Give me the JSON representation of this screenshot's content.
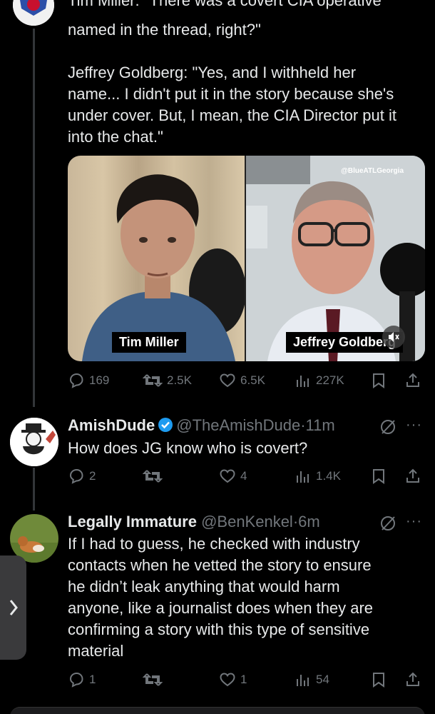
{
  "main_tweet": {
    "text_partial_top": "Tim Miller: \"There was a covert CIA operative",
    "text_line2": "named in the thread, right?\"",
    "quote_para": "Jeffrey Goldberg: \"Yes, and I withheld her\nname... I didn't put it in the story because she's\nunder cover. But, I mean, the CIA Director put it\ninto the chat.\"",
    "media": {
      "left_name_tag": "Tim Miller",
      "right_name_tag": "Jeffrey Goldberg",
      "watermark": "@BlueATLGeorgia"
    },
    "actions": {
      "replies": "169",
      "reposts": "2.5K",
      "likes": "6.5K",
      "views": "227K"
    }
  },
  "replies": [
    {
      "display_name": "AmishDude",
      "handle": "@TheAmishDude",
      "time": "11m",
      "text": "How does JG know who is covert?",
      "actions": {
        "replies": "2",
        "reposts": "",
        "likes": "4",
        "views": "1.4K"
      }
    },
    {
      "display_name": "Legally Immature",
      "handle": "@BenKenkel",
      "time": "6m",
      "text": "If I had to guess, he checked with industry\ncontacts when he vetted the story to ensure\nhe didn’t leak anything that would harm\nanyone, like a journalist does when they are\nconfirming a story with this type of sensitive\nmaterial",
      "actions": {
        "replies": "1",
        "reposts": "",
        "likes": "1",
        "views": "54"
      }
    }
  ],
  "separator_dot": "·",
  "more_glyph": "···",
  "colors": {
    "background": "#000000",
    "text": "#e7e9ea",
    "muted": "#71767b",
    "verified": "#1d9bf0",
    "thread_line": "#333639"
  },
  "icons": [
    "reply-icon",
    "repost-icon",
    "like-icon",
    "views-icon",
    "bookmark-icon",
    "share-icon",
    "verified-icon",
    "grok-icon",
    "more-icon",
    "mute-icon",
    "chevron-right-icon"
  ]
}
